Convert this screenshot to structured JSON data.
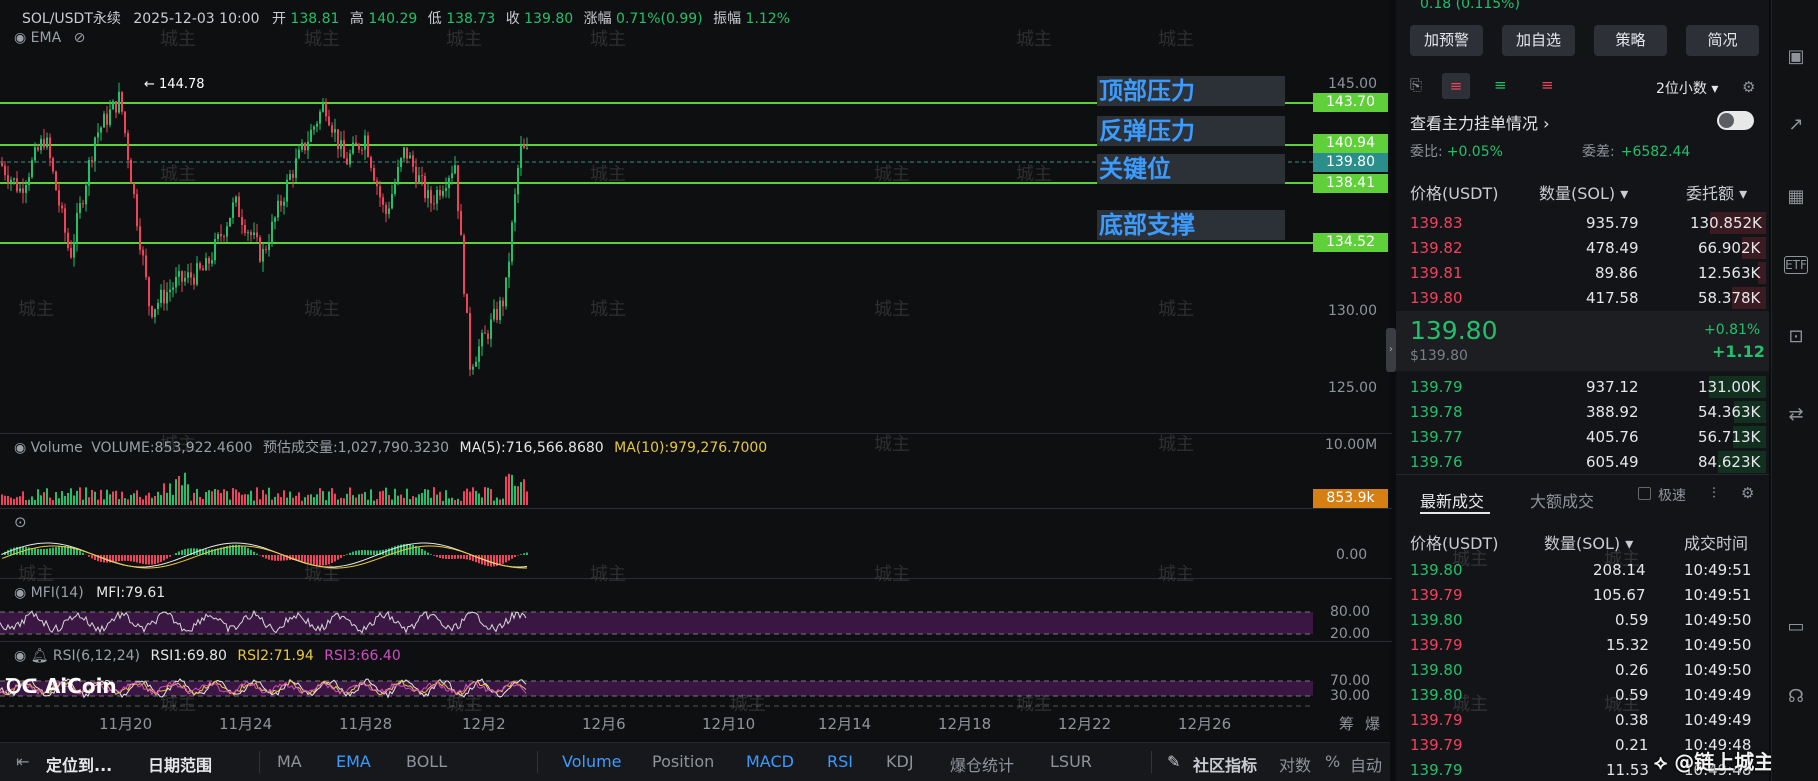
{
  "chart_header": {
    "symbol": "SOL/USDT永续",
    "datetime": "2025-12-03 10:00",
    "open_label": "开",
    "open": "138.81",
    "high_label": "高",
    "high": "140.29",
    "low_label": "低",
    "low": "138.73",
    "close_label": "收",
    "close": "139.80",
    "change_label": "涨幅",
    "change": "0.71%(0.99)",
    "amp_label": "振幅",
    "amp": "1.12%",
    "indicator": "EMA",
    "hi_marker": "← 144.78"
  },
  "levels": [
    {
      "zone": "顶部压力",
      "price": "143.70"
    },
    {
      "zone": "反弹压力",
      "price": "140.94"
    },
    {
      "zone": "关键位",
      "price": "138.41"
    },
    {
      "zone": "底部支撑",
      "price": "134.52"
    }
  ],
  "current_price_badge": "139.80",
  "y_axis": [
    "145.00",
    "130.00",
    "125.00"
  ],
  "volume": {
    "label": "Volume",
    "vol": "VOLUME:853,922.4600",
    "est": "预估成交量:1,027,790.3230",
    "ma5": "MA(5):716,566.8680",
    "ma10": "MA(10):979,276.7000",
    "max": "10.00M",
    "badge": "853.9k"
  },
  "macd": {
    "zero": "0.00"
  },
  "mfi": {
    "label": "MFI(14)",
    "value": "MFI:79.61",
    "upper": "80.00",
    "lower": "20.00"
  },
  "rsi": {
    "label": "RSI(6,12,24)",
    "rsi1": "RSI1:69.80",
    "rsi2": "RSI2:71.94",
    "rsi3": "RSI3:66.40",
    "upper": "70.00",
    "lower": "30.00"
  },
  "x_axis": [
    "11月20",
    "11月24",
    "11月28",
    "12月2",
    "12月6",
    "12月10",
    "12月14",
    "12月18",
    "12月22",
    "12月26"
  ],
  "x_right": [
    "筹",
    "爆"
  ],
  "logo": "AiCoin",
  "bottom_bar": {
    "locate": "定位到...",
    "range": "日期范围",
    "ma": "MA",
    "ema": "EMA",
    "boll": "BOLL",
    "volume": "Volume",
    "position": "Position",
    "macd": "MACD",
    "rsi": "RSI",
    "kdj": "KDJ",
    "liq": "爆仓统计",
    "lsur": "LSUR",
    "community": "社区指标",
    "log": "对数",
    "pct": "%",
    "auto": "自动"
  },
  "orderbook": {
    "top_text": "0.18 (0.115%)",
    "buttons": [
      "加预警",
      "加自选",
      "策略",
      "简况"
    ],
    "decimals": "2位小数",
    "main_orders": "查看主力挂单情况",
    "ratio_label": "委比:",
    "ratio": "+0.05%",
    "diff_label": "委差:",
    "diff": "+6582.44",
    "headers": [
      "价格(USDT)",
      "数量(SOL)",
      "委托额"
    ],
    "asks": [
      [
        "139.83",
        "935.79",
        "130.852K"
      ],
      [
        "139.82",
        "478.49",
        "66.902K"
      ],
      [
        "139.81",
        "89.86",
        "12.563K"
      ],
      [
        "139.80",
        "417.58",
        "58.378K"
      ]
    ],
    "last_price": "139.80",
    "last_usd": "$139.80",
    "last_pct": "+0.81%",
    "last_chg": "+1.12",
    "bids": [
      [
        "139.79",
        "937.12",
        "131.00K"
      ],
      [
        "139.78",
        "388.92",
        "54.363K"
      ],
      [
        "139.77",
        "405.76",
        "56.713K"
      ],
      [
        "139.76",
        "605.49",
        "84.623K"
      ]
    ]
  },
  "trades": {
    "tab_latest": "最新成交",
    "tab_large": "大额成交",
    "fast": "极速",
    "headers": [
      "价格(USDT)",
      "数量(SOL)",
      "成交时间"
    ],
    "rows": [
      [
        "139.80",
        "208.14",
        "10:49:51",
        "g"
      ],
      [
        "139.79",
        "105.67",
        "10:49:51",
        "r"
      ],
      [
        "139.80",
        "0.59",
        "10:49:50",
        "g"
      ],
      [
        "139.79",
        "15.32",
        "10:49:50",
        "r"
      ],
      [
        "139.80",
        "0.26",
        "10:49:50",
        "g"
      ],
      [
        "139.80",
        "0.59",
        "10:49:49",
        "g"
      ],
      [
        "139.79",
        "0.38",
        "10:49:49",
        "r"
      ],
      [
        "139.79",
        "0.21",
        "10:49:48",
        "r"
      ],
      [
        "139.79",
        "11.53",
        "10:49:48",
        "g"
      ]
    ]
  },
  "watermark": "城主",
  "credit": "@链上城主",
  "colors": {
    "up": "#22c06b",
    "down": "#f0435b",
    "level": "#5fcf3a",
    "accent": "#3b9bff"
  }
}
